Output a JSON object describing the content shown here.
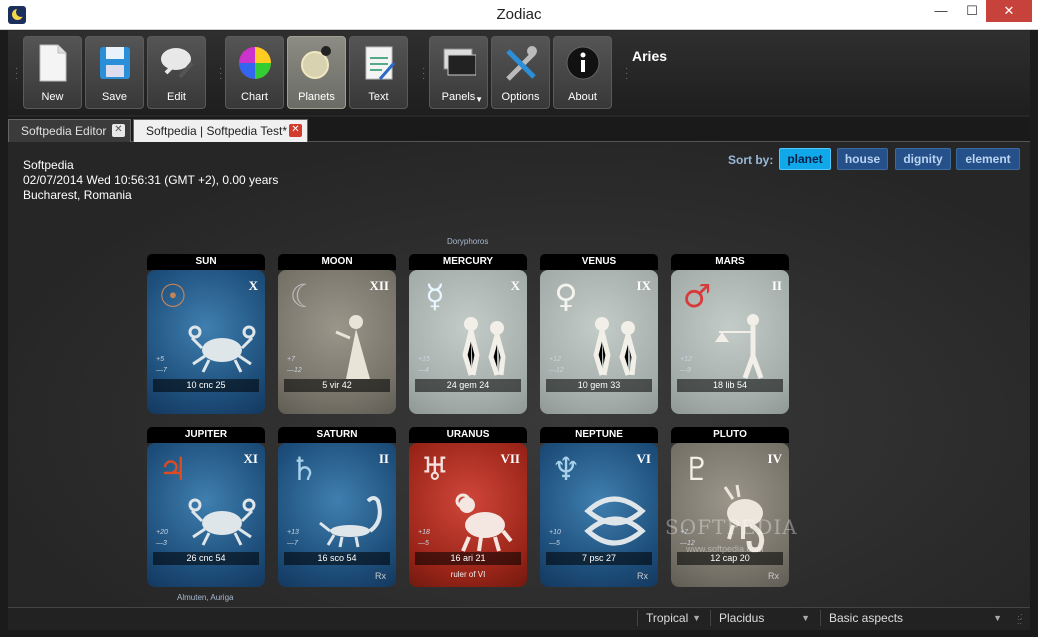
{
  "window": {
    "title": "Zodiac",
    "min": "—",
    "max": "☐",
    "close": "✕"
  },
  "toolbar": {
    "new": "New",
    "save": "Save",
    "edit": "Edit",
    "chart": "Chart",
    "planets": "Planets",
    "text": "Text",
    "panels": "Panels",
    "options": "Options",
    "about": "About",
    "sign": "Aries"
  },
  "tabs": [
    {
      "label": "Softpedia Editor",
      "close": "✕"
    },
    {
      "label": "Softpedia | Softpedia Test*",
      "close": "✕"
    }
  ],
  "info": {
    "name": "Softpedia",
    "datetime": "02/07/2014 Wed 10:56:31 (GMT +2),  0.00 years",
    "place": "Bucharest, Romania"
  },
  "sort": {
    "label": "Sort by:",
    "planet": "planet",
    "house": "house",
    "dignity": "dignity",
    "element": "element",
    "active": "planet"
  },
  "notes": {
    "top": "Doryphoros",
    "bottom": "Almuten, Auriga"
  },
  "cards": [
    {
      "planet": "SUN",
      "symbol": "☉",
      "house": "X",
      "nums": [
        "+5",
        "—7"
      ],
      "position": "10 cnc 25",
      "theme": "blue",
      "figure": "crab-icon",
      "extra": "",
      "rx": ""
    },
    {
      "planet": "MOON",
      "symbol": "☾",
      "house": "XII",
      "nums": [
        "+7",
        "—12"
      ],
      "position": "5 vir 42",
      "theme": "grey",
      "figure": "virgin-icon",
      "extra": "",
      "rx": ""
    },
    {
      "planet": "MERCURY",
      "symbol": "☿",
      "house": "X",
      "nums": [
        "+15",
        "—4"
      ],
      "position": "24 gem 24",
      "theme": "pale",
      "figure": "twins-icon",
      "extra": "",
      "rx": ""
    },
    {
      "planet": "VENUS",
      "symbol": "♀",
      "house": "IX",
      "nums": [
        "+12",
        "—12"
      ],
      "position": "10 gem 33",
      "theme": "pale",
      "figure": "twins-icon",
      "extra": "",
      "rx": ""
    },
    {
      "planet": "MARS",
      "symbol": "♂",
      "house": "II",
      "nums": [
        "+12",
        "—9"
      ],
      "position": "18 lib 54",
      "theme": "pale",
      "figure": "scales-icon",
      "extra": "",
      "rx": ""
    },
    {
      "planet": "JUPITER",
      "symbol": "♃",
      "house": "XI",
      "nums": [
        "+20",
        "—3"
      ],
      "position": "26 cnc 54",
      "theme": "blue",
      "figure": "crab-icon",
      "extra": "",
      "rx": ""
    },
    {
      "planet": "SATURN",
      "symbol": "♄",
      "house": "II",
      "nums": [
        "+13",
        "—7"
      ],
      "position": "16 sco 54",
      "theme": "blue",
      "figure": "scorpion-icon",
      "extra": "",
      "rx": "Rx"
    },
    {
      "planet": "URANUS",
      "symbol": "♅",
      "house": "VII",
      "nums": [
        "+18",
        "—5"
      ],
      "position": "16 ari 21",
      "theme": "red",
      "figure": "ram-icon",
      "extra": "ruler of VI",
      "rx": ""
    },
    {
      "planet": "NEPTUNE",
      "symbol": "♆",
      "house": "VI",
      "nums": [
        "+10",
        "—5"
      ],
      "position": "7 psc 27",
      "theme": "blue",
      "figure": "fish-icon",
      "extra": "",
      "rx": "Rx"
    },
    {
      "planet": "PLUTO",
      "symbol": "♇",
      "house": "IV",
      "nums": [
        "+7",
        "—12"
      ],
      "position": "12 cap 20",
      "theme": "grey",
      "figure": "goat-icon",
      "extra": "",
      "rx": "Rx"
    }
  ],
  "statusbar": {
    "zodiac": "Tropical",
    "houses": "Placidus",
    "aspects": "Basic aspects"
  },
  "watermark": {
    "brand": "SOFTPEDIA",
    "url": "www.softpedia.com"
  }
}
